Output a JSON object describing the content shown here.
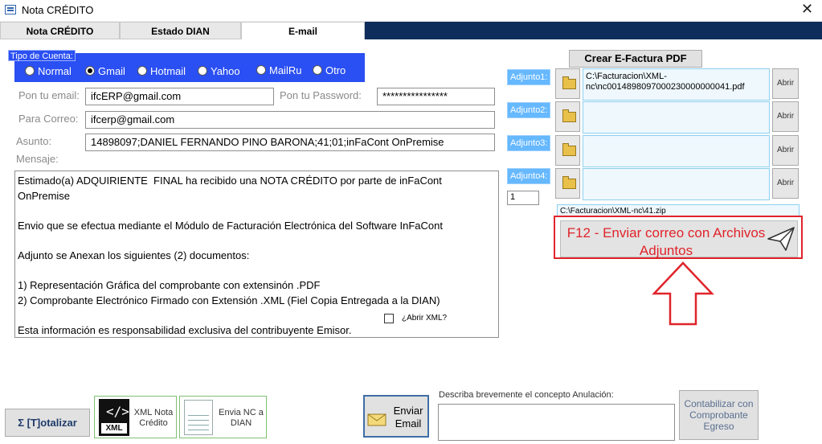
{
  "window": {
    "title": "Nota CRÉDITO",
    "close_glyph": "✕"
  },
  "tabs": [
    {
      "label": "Nota CRÉDITO",
      "active": false
    },
    {
      "label": "Estado DIAN",
      "active": false
    },
    {
      "label": "E-mail",
      "active": true
    }
  ],
  "account": {
    "group_label": "Tipo de Cuenta:",
    "options": [
      "Normal",
      "Gmail",
      "Hotmail",
      "Yahoo",
      "MailRu",
      "Otro"
    ],
    "selected": "Gmail"
  },
  "form": {
    "email_label": "Pon tu email:",
    "email_value": "ifcERP@gmail.com",
    "password_label": "Pon tu Password:",
    "password_value": "****************",
    "to_label": "Para Correo:",
    "to_value": "ifcerp@gmail.com",
    "subject_label": "Asunto:",
    "subject_value": "14898097;DANIEL FERNANDO PINO BARONA;41;01;inFaCont OnPremise",
    "message_label": "Mensaje:",
    "message_value": "Estimado(a) ADQUIRIENTE  FINAL ha recibido una NOTA CRÉDITO por parte de inFaCont\nOnPremise\n\nEnvio que se efectua mediante el Módulo de Facturación Electrónica del Software InFaCont\n\nAdjunto se Anexan los siguientes (2) documentos:\n\n1) Representación Gráfica del comprobante con extensinón .PDF\n2) Comprobante Electrónico Firmado con Extensión .XML (Fiel Copia Entregada a la DIAN)\n\nEsta información es responsabilidad exclusiva del contribuyente Emisor.",
    "xml_checkbox_label": "¿Abrir XML?"
  },
  "attachments": {
    "create_pdf_label": "Crear E-Factura PDF",
    "items": [
      {
        "label": "Adjunto1:",
        "path": "C:\\Facturacion\\XML-nc\\nc0014898097000230000000041.pdf",
        "open_label": "Abrir"
      },
      {
        "label": "Adjunto2:",
        "path": "",
        "open_label": "Abrir"
      },
      {
        "label": "Adjunto3:",
        "path": "",
        "open_label": "Abrir"
      },
      {
        "label": "Adjunto4:",
        "path": "",
        "open_label": "Abrir"
      }
    ],
    "counter_value": "1",
    "zip_path": "C:\\Facturacion\\XML-nc\\41.zip",
    "send_f12_label": "F12 - Enviar correo con Archivos Adjuntos"
  },
  "bottom": {
    "totalize_label": "Σ [T]otalizar",
    "xml_tile_label": "XML Nota Crédito",
    "xml_tile_badge": "XML",
    "send_nc_label": "Envia NC a DIAN",
    "send_email_label": "Enviar Email",
    "annul_label": "Describa brevemente el concepto Anulación:",
    "annul_value": "",
    "accounting_label": "Contabilizar con Comprobante Egreso"
  },
  "colors": {
    "account_group": "#2a4ff2",
    "attachment_label": "#66b8ff",
    "highlight_red": "#e0242b",
    "tab_band": "#0f2d5a",
    "accounting_text": "#5a6f8f"
  }
}
